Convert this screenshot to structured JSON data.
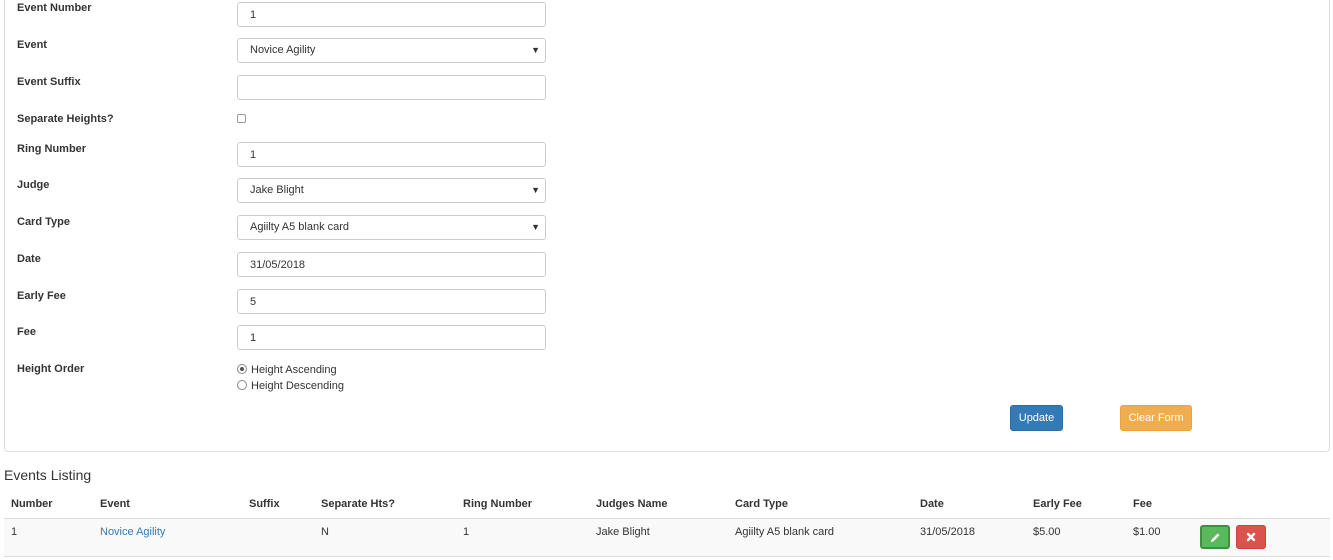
{
  "form": {
    "event_number": {
      "label": "Event Number",
      "value": "1"
    },
    "event": {
      "label": "Event",
      "value": "Novice Agility"
    },
    "event_suffix": {
      "label": "Event Suffix",
      "value": ""
    },
    "separate_heights": {
      "label": "Separate Heights?",
      "checked": false
    },
    "ring_number": {
      "label": "Ring Number",
      "value": "1"
    },
    "judge": {
      "label": "Judge",
      "value": "Jake Blight"
    },
    "card_type": {
      "label": "Card Type",
      "value": "Agiilty A5 blank card"
    },
    "date": {
      "label": "Date",
      "value": "31/05/2018"
    },
    "early_fee": {
      "label": "Early Fee",
      "value": "5"
    },
    "fee": {
      "label": "Fee",
      "value": "1"
    },
    "height_order": {
      "label": "Height Order",
      "options": [
        "Height Ascending",
        "Height Descending"
      ],
      "selected": "Height Ascending"
    },
    "buttons": {
      "update": "Update",
      "clear": "Clear Form"
    }
  },
  "listing": {
    "title": "Events Listing",
    "columns": [
      "Number",
      "Event",
      "Suffix",
      "Separate Hts?",
      "Ring Number",
      "Judges Name",
      "Card Type",
      "Date",
      "Early Fee",
      "Fee"
    ],
    "rows": [
      {
        "number": "1",
        "event": "Novice Agility",
        "suffix": "",
        "separate_hts": "N",
        "ring_number": "1",
        "judges_name": "Jake Blight",
        "card_type": "Agiilty A5 blank card",
        "date": "31/05/2018",
        "early_fee": "$5.00",
        "fee": "$1.00"
      }
    ]
  },
  "icons": {
    "select_caret": "▼",
    "edit": "pencil-icon",
    "delete": "times-icon"
  },
  "colors": {
    "primary": "#337ab7",
    "warning": "#f0ad4e",
    "success": "#5cb85c",
    "danger": "#d9534f"
  }
}
